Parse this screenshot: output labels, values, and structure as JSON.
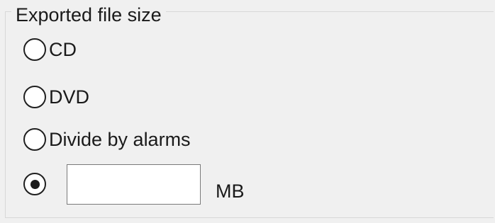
{
  "group": {
    "title": "Exported file size"
  },
  "options": [
    {
      "label": "CD",
      "selected": false
    },
    {
      "label": "DVD",
      "selected": false
    },
    {
      "label": "Divide by alarms",
      "selected": false
    },
    {
      "label": "",
      "selected": true
    }
  ],
  "custom_size": {
    "value": "",
    "unit": "MB"
  }
}
